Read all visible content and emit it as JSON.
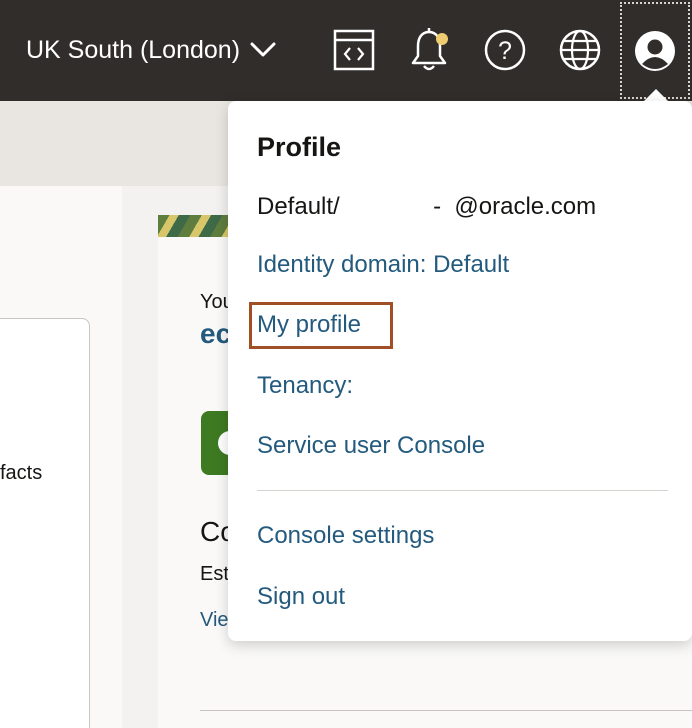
{
  "topbar": {
    "region_label": "UK South (London)",
    "icons": {
      "code": "code-editor-icon",
      "bell": "notifications-bell-icon",
      "help": "help-icon",
      "globe": "language-globe-icon",
      "profile": "user-profile-icon"
    },
    "bell_dot_color": "#f0cc71"
  },
  "background": {
    "left_text": "facts",
    "greeting_partial": "You",
    "name_partial": "ec",
    "section_heading_partial": "Co",
    "section_sub_partial": "Est",
    "link_partial": "Vie"
  },
  "profile_menu": {
    "title": "Profile",
    "user_line": "Default/              -  @oracle.com",
    "identity_domain": "Identity domain: Default",
    "my_profile": "My profile",
    "tenancy": "Tenancy:",
    "service_user_console": "Service user Console",
    "console_settings": "Console settings",
    "sign_out": "Sign out"
  },
  "colors": {
    "topbar": "#312d2a",
    "link": "#235a7e",
    "highlight_border": "#a04f27"
  }
}
